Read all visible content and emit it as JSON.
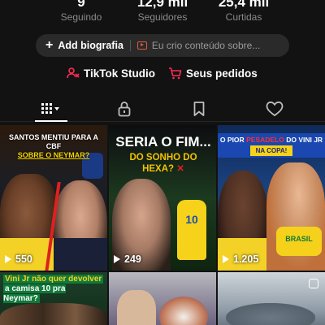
{
  "stats": [
    {
      "value": "9",
      "label": "Seguindo"
    },
    {
      "value": "12,9 mil",
      "label": "Seguidores"
    },
    {
      "value": "25,4 mil",
      "label": "Curtidas"
    }
  ],
  "bio": {
    "add_label": "Add biografia",
    "creator_text": "Eu crio conteúdo sobre..."
  },
  "shortcuts": {
    "studio_label": "TikTok Studio",
    "orders_label": "Seus pedidos"
  },
  "tabs": [
    {
      "icon": "videos-grid-icon",
      "active": true
    },
    {
      "icon": "lock-icon",
      "active": false
    },
    {
      "icon": "bookmark-icon",
      "active": false
    },
    {
      "icon": "heart-icon",
      "active": false
    }
  ],
  "videos": [
    {
      "headline_1": "SANTOS MENTIU PARA A CBF",
      "headline_2": "SOBRE O NEYMAR?",
      "views": "550"
    },
    {
      "title_1": "SERIA O FIM...",
      "title_2": "DO SONHO DO HEXA?",
      "title_mark": "✕",
      "jersey": "10",
      "views": "249"
    },
    {
      "banner_1": "O PIOR",
      "banner_red": "PESADELO",
      "banner_2": "DO VINI JR",
      "banner_sub": "NA COPA!",
      "shirt_text": "BRASIL",
      "views": "1.205"
    },
    {
      "caption_1": "Vini Jr não quer devolver",
      "caption_2": "a camisa 10 pra Neymar?"
    },
    {},
    {}
  ],
  "colors": {
    "background": "#121212",
    "pill": "#2a2a2a",
    "accent_red": "#fe2c55"
  }
}
